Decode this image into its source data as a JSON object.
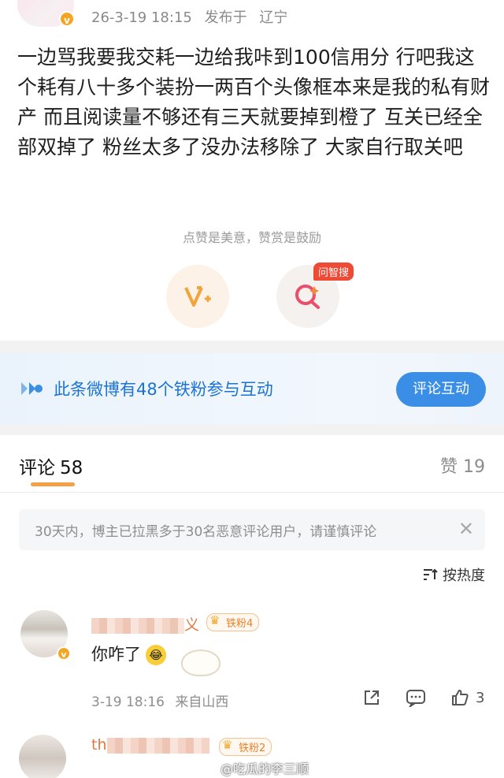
{
  "post": {
    "date": "26-3-19 18:15",
    "published_label": "发布于",
    "location": "辽宁",
    "text": "一边骂我要我交耗一边给我咔到100信用分 行吧我这个耗有八十多个装扮一两百个头像框本来是我的私有财产 而且阅读量不够还有三天就要掉到橙了 互关已经全部双掉了 粉丝太多了没办法移除了 大家自行取关吧",
    "encourage_text": "点赞是美意，赞赏是鼓励",
    "ask_badge": "问智搜"
  },
  "fans_bar": {
    "text": "此条微博有48个铁粉参与互动",
    "button": "评论互动"
  },
  "comments_header": {
    "title": "评论",
    "count": "58",
    "likes_label": "赞 19"
  },
  "notice": {
    "text": "30天内，博主已拉黑多于30名恶意评论用户，请谨慎评论"
  },
  "sort": {
    "label": "按热度"
  },
  "comments": [
    {
      "user_suffix": "义",
      "fan_badge": "铁粉4",
      "text": "你咋了",
      "date": "3-19 18:16",
      "location": "来自山西",
      "likes": "3"
    },
    {
      "user_prefix": "th",
      "fan_badge": "铁粉2"
    }
  ],
  "watermark": "@吃瓜的李三顺",
  "colors": {
    "accent_blue": "#1c73d4",
    "button_blue": "#3a8ee6",
    "username_orange": "#e07840",
    "underline_orange": "#f3a046"
  }
}
